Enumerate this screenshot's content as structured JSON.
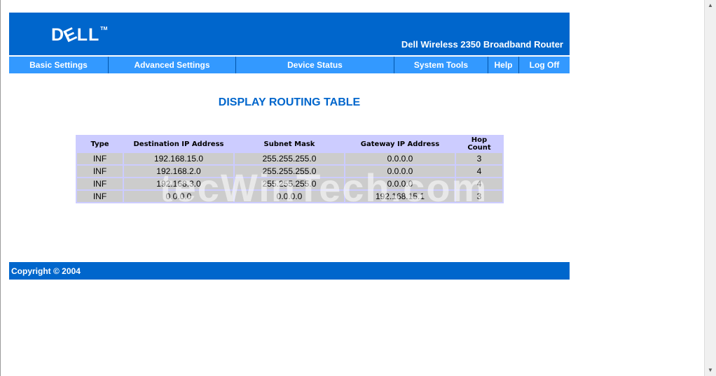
{
  "header": {
    "logo_text": "DELL",
    "logo_tm": "TM",
    "product_name": "Dell Wireless 2350 Broadband Router",
    "brand_color": "#0066cc"
  },
  "nav": {
    "items": [
      {
        "label": "Basic Settings"
      },
      {
        "label": "Advanced Settings"
      },
      {
        "label": "Device Status"
      },
      {
        "label": "System Tools"
      },
      {
        "label": "Help"
      },
      {
        "label": "Log Off"
      }
    ],
    "color": "#3399ff"
  },
  "main": {
    "title": "DISPLAY ROUTING TABLE",
    "table": {
      "headers": [
        "Type",
        "Destination IP Address",
        "Subnet Mask",
        "Gateway IP Address",
        "Hop Count"
      ],
      "rows": [
        [
          "INF",
          "192.168.15.0",
          "255.255.255.0",
          "0.0.0.0",
          "3"
        ],
        [
          "INF",
          "192.168.2.0",
          "255.255.255.0",
          "0.0.0.0",
          "4"
        ],
        [
          "INF",
          "192.168.3.0",
          "255.255.255.0",
          "0.0.0.0",
          "4"
        ],
        [
          "INF",
          "0.0.0.0",
          "0.0.0.0",
          "192.168.15.1",
          "3"
        ]
      ]
    },
    "watermark": "tecWinTech.com"
  },
  "footer": {
    "copyright": "Copyright © 2004"
  },
  "scrollbar": {
    "up_icon": "arrow-up-icon",
    "down_icon": "arrow-down-icon"
  }
}
